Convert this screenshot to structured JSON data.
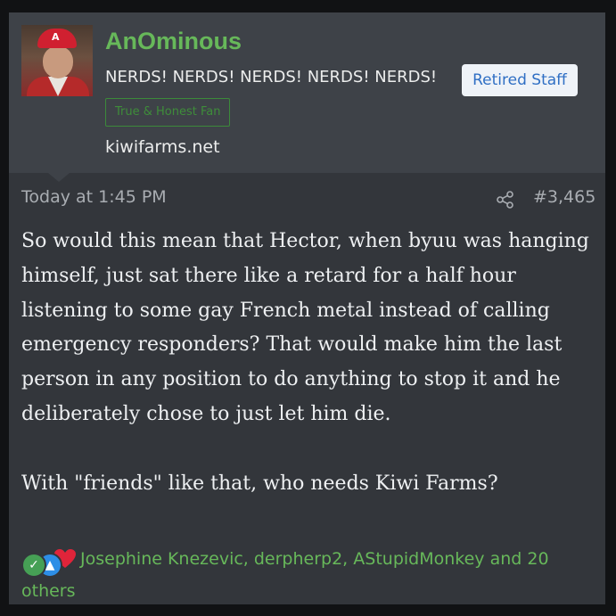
{
  "author": {
    "name": "AnOminous",
    "title": "NERDS! NERDS! NERDS! NERDS! NERDS!",
    "staff_badge": "Retired Staff",
    "fan_badge": "True & Honest Fan",
    "site": "kiwifarms.net",
    "avatar_cap_letter": "A"
  },
  "post": {
    "time": "Today at 1:45 PM",
    "number": "#3,465",
    "paragraph1": "So would this mean that Hector, when byuu was hanging himself, just sat there like a retard for a half hour listening to some gay French metal instead of calling emergency responders? That would make him the last person in any position to do anything to stop it and he deliberately chose to just let him die.",
    "paragraph2": "With \"friends\" like that, who needs Kiwi Farms?"
  },
  "reactions": {
    "icons": [
      "check-reaction-icon",
      "like-reaction-icon",
      "heart-reaction-icon"
    ],
    "names": "Josephine Knezevic, derpherp2, AStupidMonkey and 20 others"
  },
  "colors": {
    "username": "#67b85a",
    "header_bg": "#3e4248",
    "body_bg": "#33363b",
    "staff_badge_text": "#2f6fc4"
  }
}
